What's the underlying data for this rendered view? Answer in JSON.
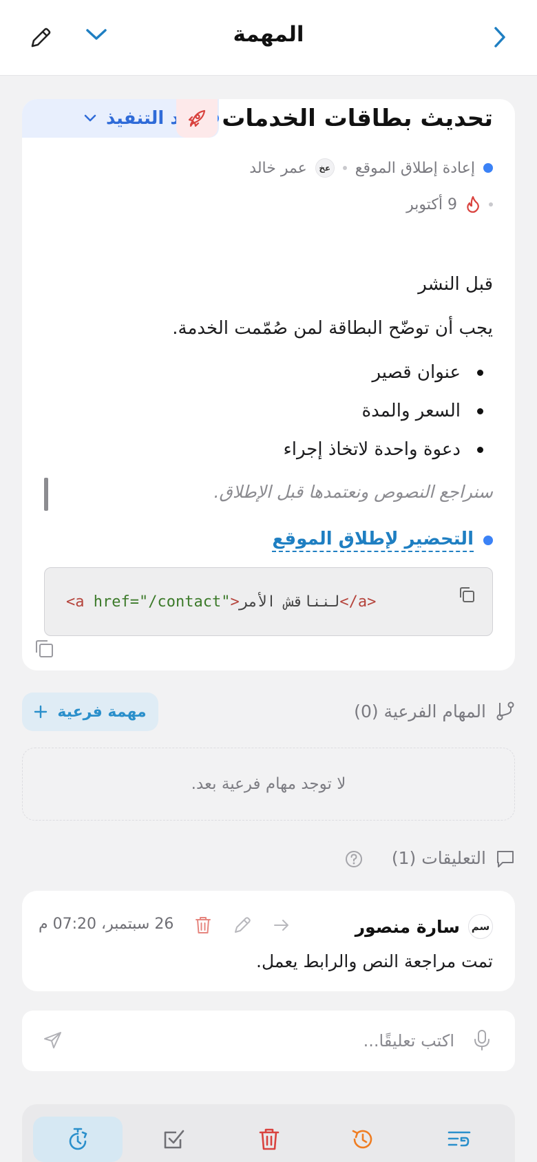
{
  "header": {
    "title": "المهمة",
    "back_icon": "chevron-right-icon",
    "expand_icon": "chevron-down-icon",
    "edit_icon": "pencil-icon"
  },
  "task": {
    "title": "تحديث بطاقات الخدمات",
    "status": "قيد التنفيذ",
    "status_color": "#3b82f6",
    "project": "إعادة إطلاق الموقع",
    "assignee_initials": "عخ",
    "assignee": "عمر خالد",
    "due_date": "9 أكتوبر",
    "priority_icon": "flame-icon",
    "description": {
      "heading": "قبل النشر",
      "paragraph": "يجب أن توضّح البطاقة لمن صُمّمت الخدمة.",
      "bullets": [
        "عنوان قصير",
        "السعر والمدة",
        "دعوة واحدة لاتخاذ إجراء"
      ],
      "quote": "سنراجع النصوص ونعتمدها قبل الإطلاق.",
      "link": "التحضير لإطلاق الموقع",
      "code": {
        "open_tag": "<a",
        "attr": "href=",
        "value": "\"/contact\"",
        "close_open": ">",
        "text": "لنناقش الأمر",
        "close_tag": "</a>"
      }
    }
  },
  "subtasks": {
    "heading": "المهام الفرعية (0)",
    "add_label": "مهمة فرعية",
    "empty_text": "لا توجد مهام فرعية بعد."
  },
  "comments": {
    "heading": "التعليقات (1)",
    "items": [
      {
        "initials": "سم",
        "author": "سارة منصور",
        "time": "26 سبتمبر، 07:20 م",
        "text": "تمت مراجعة النص والرابط يعمل."
      }
    ],
    "input_placeholder": "اكتب تعليقًا..."
  },
  "toolbar": {
    "items": [
      "timer-icon",
      "checkbox-icon",
      "trash-icon",
      "history-icon",
      "list-icon"
    ]
  },
  "colors": {
    "accent": "#1f7fc2",
    "danger": "#d9423e",
    "orange": "#ef7d22"
  }
}
